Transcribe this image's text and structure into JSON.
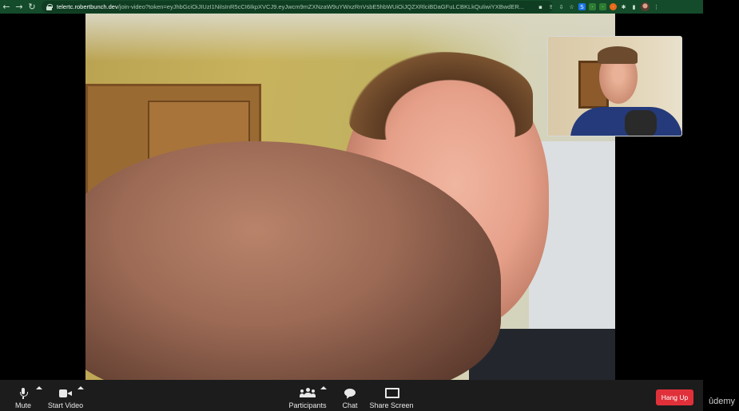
{
  "browser": {
    "url_host": "telertc.robertbunch.dev",
    "url_path": "/join-video?token=eyJhbGciOiJIUzI1NiIsInR5cCI6IkpXVCJ9.eyJwcm9mZXNzaW9uYWxzRnVsbE5hbWUiOiJQZXRlciBDaGFuLCBKLkQuIiwiYXBwdER..."
  },
  "controls": {
    "mute_label": "Mute",
    "start_video_label": "Start Video",
    "participants_label": "Participants",
    "chat_label": "Chat",
    "share_screen_label": "Share Screen",
    "hang_up_label": "Hang Up"
  },
  "watermark": "ûdemy",
  "colors": {
    "chrome_toolbar": "#144b2b",
    "control_bar": "#1c1c1c",
    "hang_up": "#e0313b"
  },
  "icons": [
    "back-arrow-icon",
    "forward-arrow-icon",
    "reload-icon",
    "lock-icon",
    "microphone-icon",
    "camera-icon",
    "participants-icon",
    "chat-icon",
    "share-screen-icon"
  ]
}
